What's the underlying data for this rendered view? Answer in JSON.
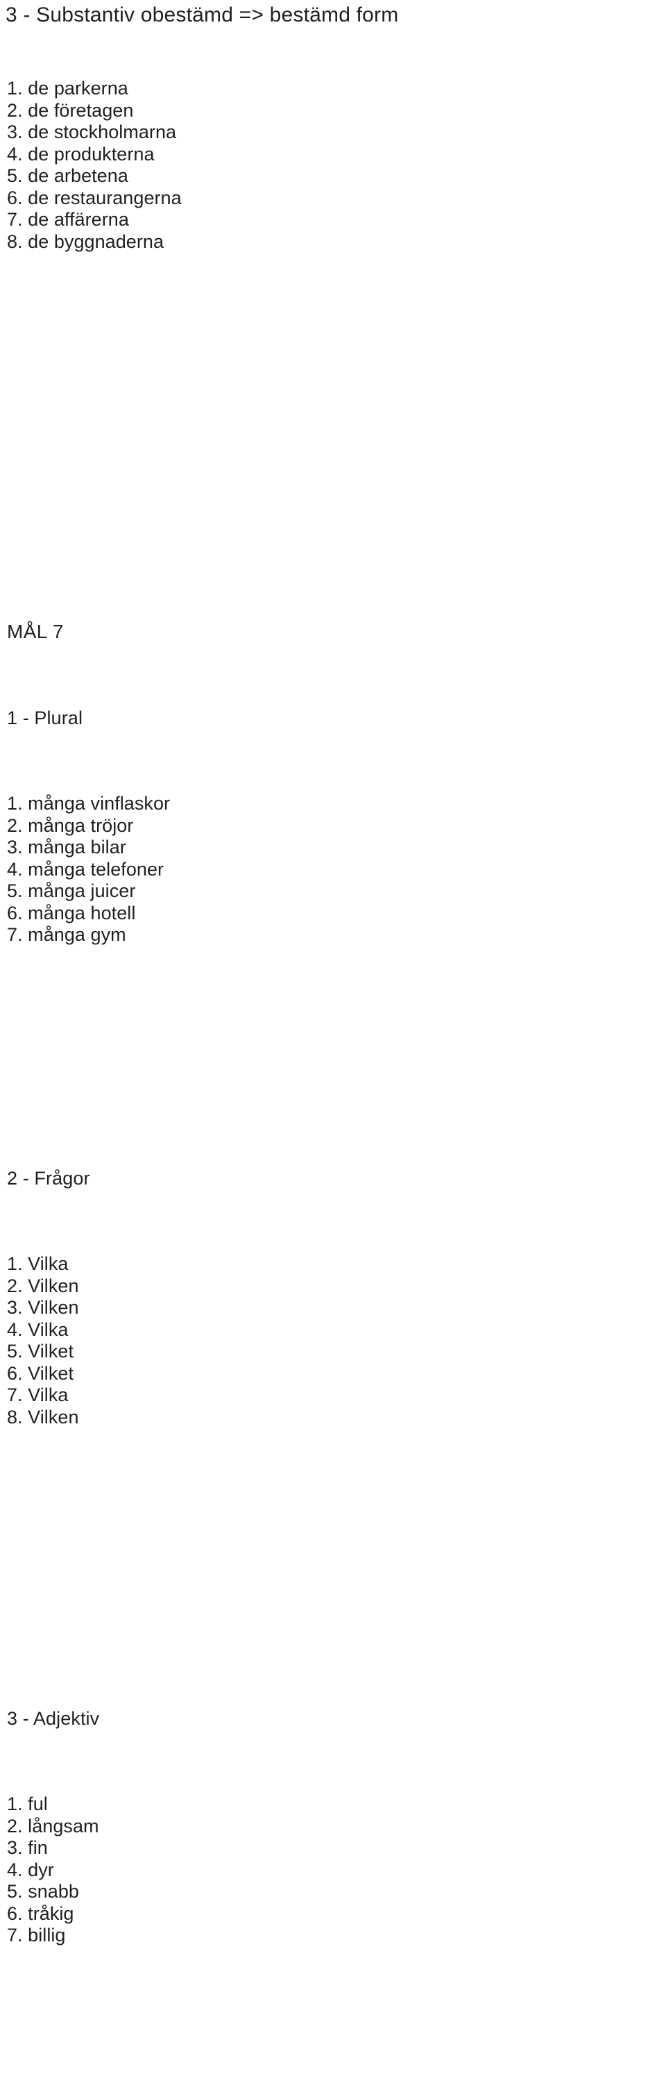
{
  "document": {
    "heading": "3  -  Substantiv obestämd => bestämd form",
    "text_color": "#231f20",
    "background_color": "#ffffff"
  },
  "section_substantiv": {
    "items": [
      {
        "num": "1.",
        "text": "de parkerna"
      },
      {
        "num": "2.",
        "text": "de företagen"
      },
      {
        "num": "3.",
        "text": "de stockholmarna"
      },
      {
        "num": "4.",
        "text": "de produkterna"
      },
      {
        "num": "5.",
        "text": "de arbetena"
      },
      {
        "num": "6.",
        "text": "de restaurangerna"
      },
      {
        "num": "7.",
        "text": "de affärerna"
      },
      {
        "num": "8.",
        "text": "de byggnaderna"
      }
    ]
  },
  "mal": {
    "title": "MÅL 7"
  },
  "section_plural": {
    "title": "1 - Plural",
    "items": [
      {
        "num": "1.",
        "text": "många vinflaskor"
      },
      {
        "num": "2.",
        "text": "många tröjor"
      },
      {
        "num": "3.",
        "text": "många bilar"
      },
      {
        "num": "4.",
        "text": "många telefoner"
      },
      {
        "num": "5.",
        "text": "många juicer"
      },
      {
        "num": "6.",
        "text": "många hotell"
      },
      {
        "num": "7.",
        "text": "många gym"
      }
    ]
  },
  "section_fragor": {
    "title": "2 - Frågor",
    "items": [
      {
        "num": "1.",
        "text": "Vilka"
      },
      {
        "num": "2.",
        "text": "Vilken"
      },
      {
        "num": "3.",
        "text": "Vilken"
      },
      {
        "num": "4.",
        "text": "Vilka"
      },
      {
        "num": "5.",
        "text": "Vilket"
      },
      {
        "num": "6.",
        "text": "Vilket"
      },
      {
        "num": "7.",
        "text": "Vilka"
      },
      {
        "num": "8.",
        "text": "Vilken"
      }
    ]
  },
  "section_adjektiv": {
    "title": "3 - Adjektiv",
    "items": [
      {
        "num": "1.",
        "text": "ful"
      },
      {
        "num": "2.",
        "text": "långsam"
      },
      {
        "num": "3.",
        "text": "fin"
      },
      {
        "num": "4.",
        "text": "dyr"
      },
      {
        "num": "5.",
        "text": "snabb"
      },
      {
        "num": "6.",
        "text": "tråkig"
      },
      {
        "num": "7.",
        "text": "billig"
      }
    ]
  }
}
